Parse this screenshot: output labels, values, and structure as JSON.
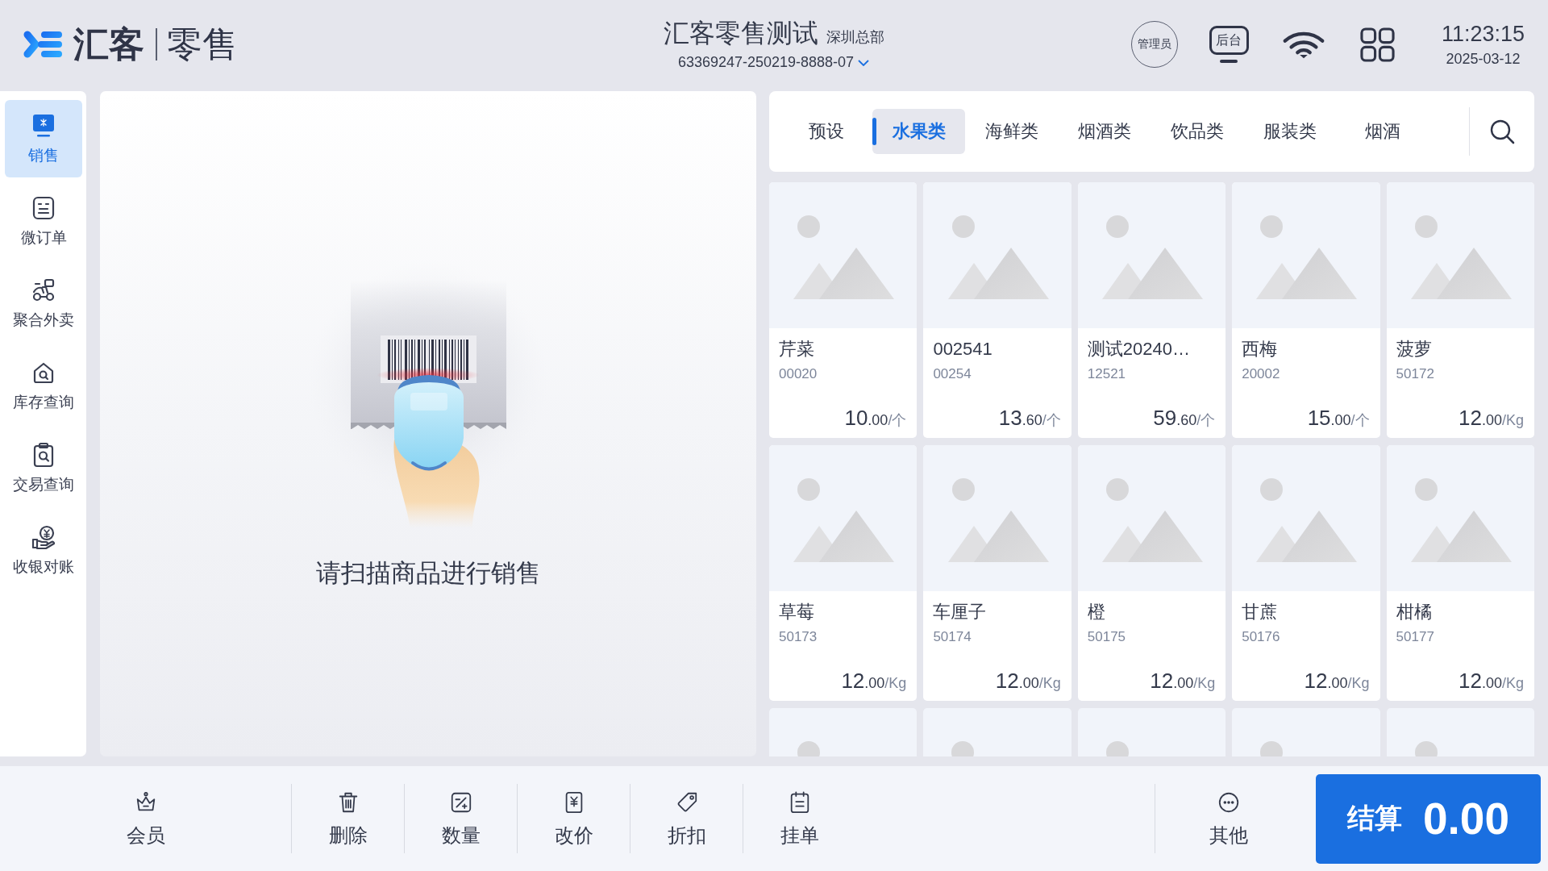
{
  "header": {
    "logo": {
      "brand": "汇客",
      "product": "零售"
    },
    "store": {
      "name": "汇客零售测试",
      "branch": "深圳总部",
      "terminal": "63369247-250219-8888-07"
    },
    "user": {
      "role": "管理员"
    },
    "backend": {
      "label": "后台"
    },
    "clock": {
      "time": "11:23:15",
      "date": "2025-03-12"
    }
  },
  "sidebar": {
    "items": [
      {
        "label": "销售",
        "selected": true
      },
      {
        "label": "微订单",
        "selected": false
      },
      {
        "label": "聚合外卖",
        "selected": false
      },
      {
        "label": "库存查询",
        "selected": false
      },
      {
        "label": "交易查询",
        "selected": false
      },
      {
        "label": "收银对账",
        "selected": false
      }
    ]
  },
  "scan_panel": {
    "prompt": "请扫描商品进行销售"
  },
  "category_tabs": [
    {
      "label": "预设",
      "selected": false
    },
    {
      "label": "水果类",
      "selected": true
    },
    {
      "label": "海鲜类",
      "selected": false
    },
    {
      "label": "烟酒类",
      "selected": false
    },
    {
      "label": "饮品类",
      "selected": false
    },
    {
      "label": "服装类",
      "selected": false
    },
    {
      "label": "烟酒",
      "selected": false
    }
  ],
  "products": [
    {
      "kind": "full",
      "name": "芹菜",
      "code": "00020",
      "price": "10",
      "decimals": ".00",
      "unit": "/个"
    },
    {
      "kind": "full",
      "name": "002541",
      "code": "00254",
      "price": "13",
      "decimals": ".60",
      "unit": "/个"
    },
    {
      "kind": "full",
      "name": "测试20240…",
      "code": "12521",
      "price": "59",
      "decimals": ".60",
      "unit": "/个"
    },
    {
      "kind": "full",
      "name": "西梅",
      "code": "20002",
      "price": "15",
      "decimals": ".00",
      "unit": "/个"
    },
    {
      "kind": "full",
      "name": "菠萝",
      "code": "50172",
      "price": "12",
      "decimals": ".00",
      "unit": "/Kg"
    },
    {
      "kind": "full",
      "name": "草莓",
      "code": "50173",
      "price": "12",
      "decimals": ".00",
      "unit": "/Kg"
    },
    {
      "kind": "full",
      "name": "车厘子",
      "code": "50174",
      "price": "12",
      "decimals": ".00",
      "unit": "/Kg"
    },
    {
      "kind": "full",
      "name": "橙",
      "code": "50175",
      "price": "12",
      "decimals": ".00",
      "unit": "/Kg"
    },
    {
      "kind": "full",
      "name": "甘蔗",
      "code": "50176",
      "price": "12",
      "decimals": ".00",
      "unit": "/Kg"
    },
    {
      "kind": "full",
      "name": "柑橘",
      "code": "50177",
      "price": "12",
      "decimals": ".00",
      "unit": "/Kg"
    },
    {
      "kind": "image_only"
    },
    {
      "kind": "image_only"
    },
    {
      "kind": "image_only"
    },
    {
      "kind": "image_only"
    },
    {
      "kind": "image_only"
    }
  ],
  "toolbar": {
    "left": [
      {
        "label": "会员"
      },
      {
        "label": "删除"
      },
      {
        "label": "数量"
      },
      {
        "label": "改价"
      },
      {
        "label": "折扣"
      },
      {
        "label": "挂单"
      }
    ],
    "right": [
      {
        "label": "其他"
      }
    ]
  },
  "checkout": {
    "label": "结算",
    "total": "0.00"
  }
}
